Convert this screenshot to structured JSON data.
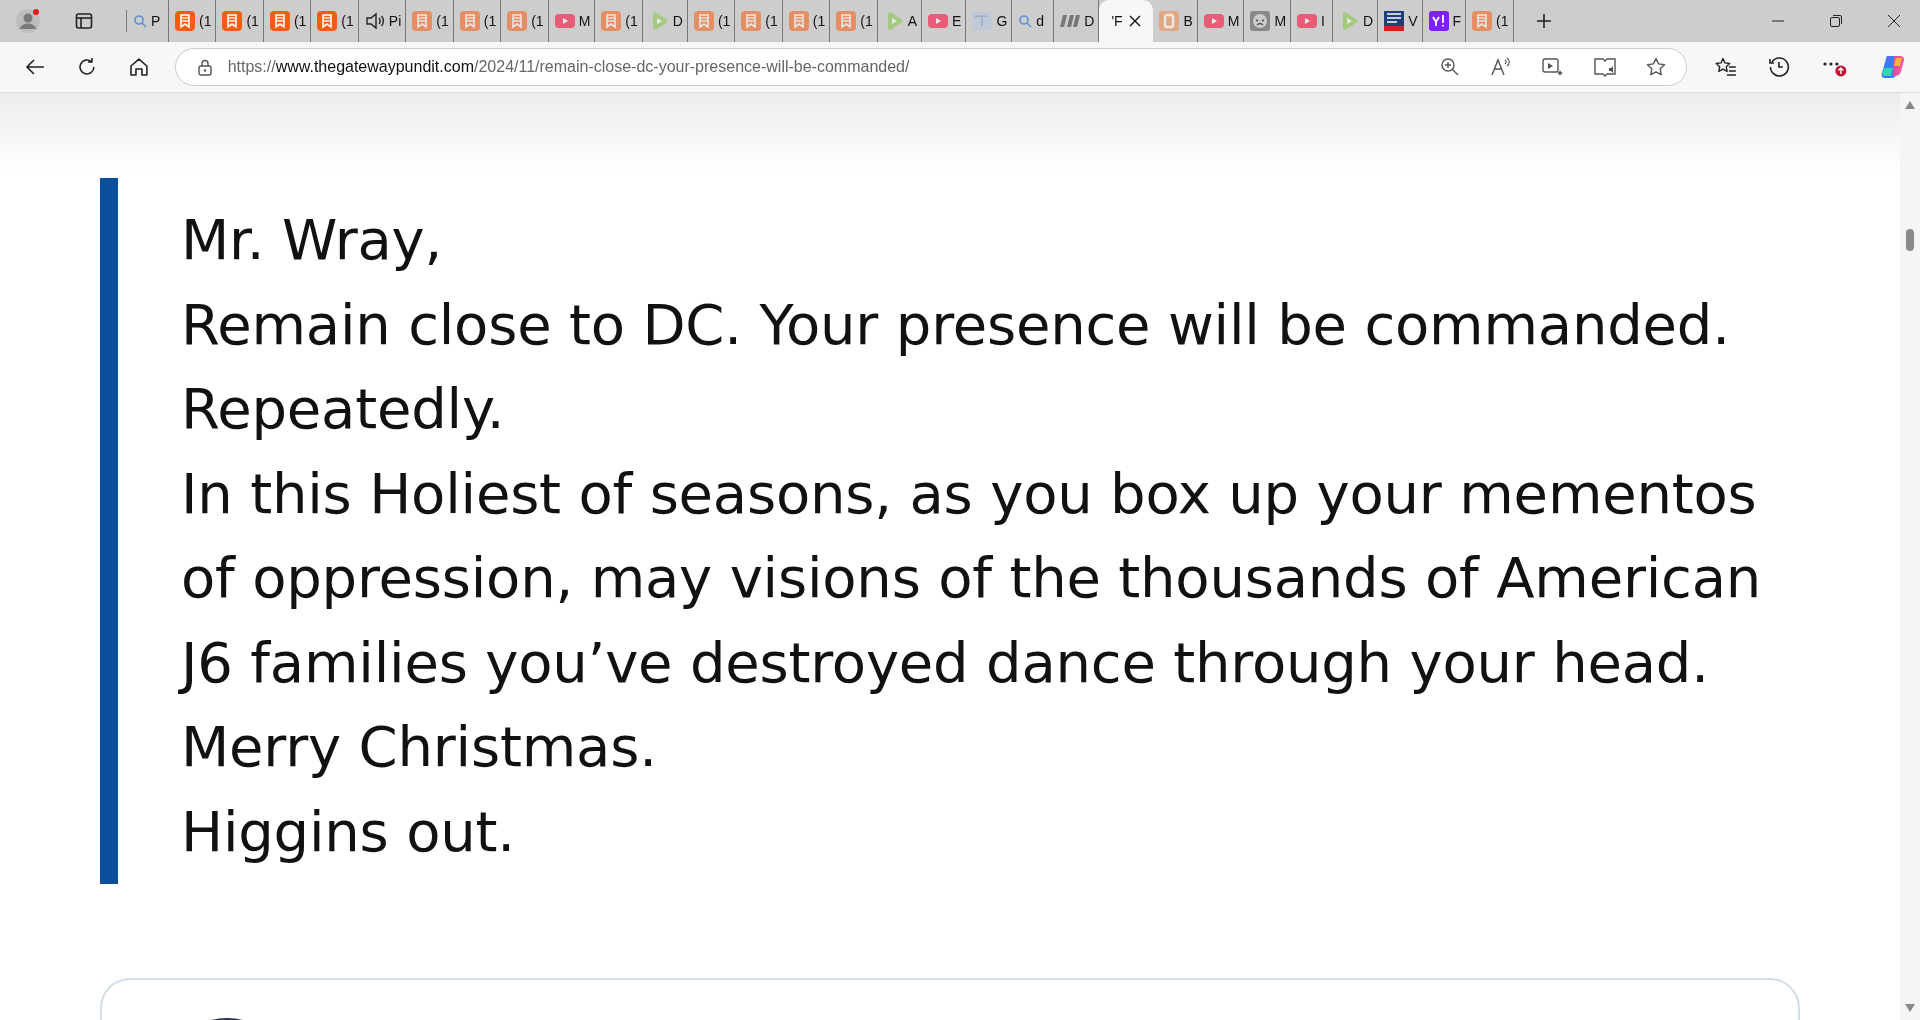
{
  "tabs": [
    {
      "kind": "search",
      "title": "P",
      "asleep": false,
      "selected": false
    },
    {
      "kind": "bookmark",
      "title": "(1",
      "asleep": false,
      "selected": false
    },
    {
      "kind": "bookmark",
      "title": "(1",
      "asleep": false,
      "selected": false
    },
    {
      "kind": "bookmark",
      "title": "(1",
      "asleep": false,
      "selected": false
    },
    {
      "kind": "bookmark",
      "title": "(1",
      "asleep": false,
      "selected": false
    },
    {
      "kind": "speaker",
      "title": "Pi",
      "asleep": false,
      "selected": false
    },
    {
      "kind": "bookmark",
      "title": "(1",
      "asleep": true,
      "selected": false
    },
    {
      "kind": "bookmark",
      "title": "(1",
      "asleep": true,
      "selected": false
    },
    {
      "kind": "bookmark",
      "title": "(1",
      "asleep": true,
      "selected": false
    },
    {
      "kind": "video",
      "title": "M",
      "asleep": true,
      "selected": false
    },
    {
      "kind": "bookmark",
      "title": "(1",
      "asleep": true,
      "selected": false
    },
    {
      "kind": "play",
      "title": "D",
      "asleep": true,
      "selected": false
    },
    {
      "kind": "bookmark",
      "title": "(1",
      "asleep": true,
      "selected": false
    },
    {
      "kind": "bookmark",
      "title": "(1",
      "asleep": true,
      "selected": false
    },
    {
      "kind": "bookmark",
      "title": "(1",
      "asleep": true,
      "selected": false
    },
    {
      "kind": "bookmark",
      "title": "(1",
      "asleep": true,
      "selected": false
    },
    {
      "kind": "play",
      "title": "A",
      "asleep": true,
      "selected": false
    },
    {
      "kind": "video",
      "title": "E",
      "asleep": true,
      "selected": false
    },
    {
      "kind": "image",
      "title": "G",
      "asleep": true,
      "selected": false
    },
    {
      "kind": "search",
      "title": "d",
      "asleep": false,
      "selected": false
    },
    {
      "kind": "letters",
      "title": "D",
      "asleep": false,
      "selected": false
    },
    {
      "kind": "none",
      "title": "'F",
      "asleep": false,
      "selected": true
    },
    {
      "kind": "bold-letter",
      "title": "B",
      "asleep": true,
      "selected": false
    },
    {
      "kind": "video",
      "title": "M",
      "asleep": true,
      "selected": false
    },
    {
      "kind": "mask",
      "title": "M",
      "asleep": false,
      "selected": false
    },
    {
      "kind": "video",
      "title": "I",
      "asleep": true,
      "selected": false
    },
    {
      "kind": "play",
      "title": "D",
      "asleep": true,
      "selected": false
    },
    {
      "kind": "news",
      "title": "V",
      "asleep": false,
      "selected": false
    },
    {
      "kind": "exclaim",
      "title": "F",
      "asleep": false,
      "selected": false
    },
    {
      "kind": "bookmark",
      "title": "(1",
      "asleep": true,
      "selected": false
    }
  ],
  "address_bar": {
    "scheme": "https://",
    "host": "www.thegatewaypundit.com",
    "path": "/2024/11/remain-close-dc-your-presence-will-be-commanded/"
  },
  "quote": {
    "lines": [
      "Mr. Wray,",
      "Remain close to DC. Your presence will be commanded. Repeatedly.",
      "In this Holiest of seasons, as you box up your mementos of oppression, may visions of the thousands of American J6 families you’ve destroyed dance through your head.",
      "Merry Christmas.",
      "Higgins out."
    ]
  }
}
